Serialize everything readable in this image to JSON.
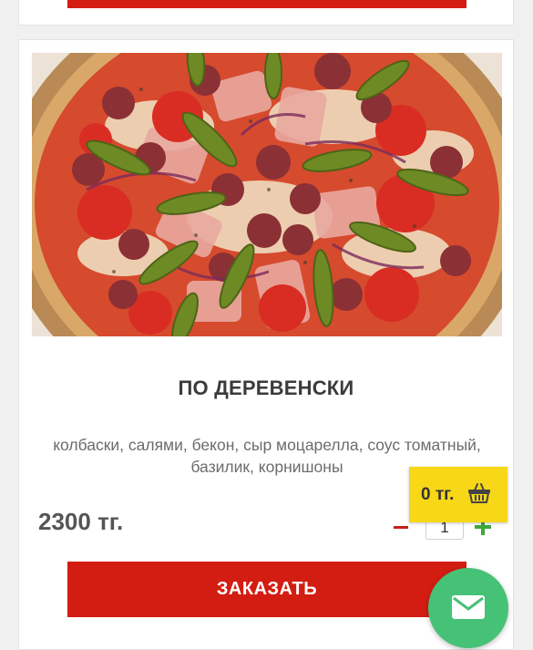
{
  "product": {
    "title": "ПО ДЕРЕВЕНСКИ",
    "description": "колбаски, салями, бекон, сыр моцарелла, соус томатный, базилик, корнишоны",
    "price": "2300 тг.",
    "quantity": "1",
    "order_label": "ЗАКАЗАТЬ",
    "image_icon": "pizza-photo"
  },
  "cart": {
    "total": "0 тг.",
    "icon": "basket-icon"
  },
  "contact": {
    "icon": "mail-icon"
  },
  "colors": {
    "accent_red": "#d31d12",
    "cart_yellow": "#f7d716",
    "plus_green": "#3ea83c",
    "mail_green": "#45c276"
  }
}
